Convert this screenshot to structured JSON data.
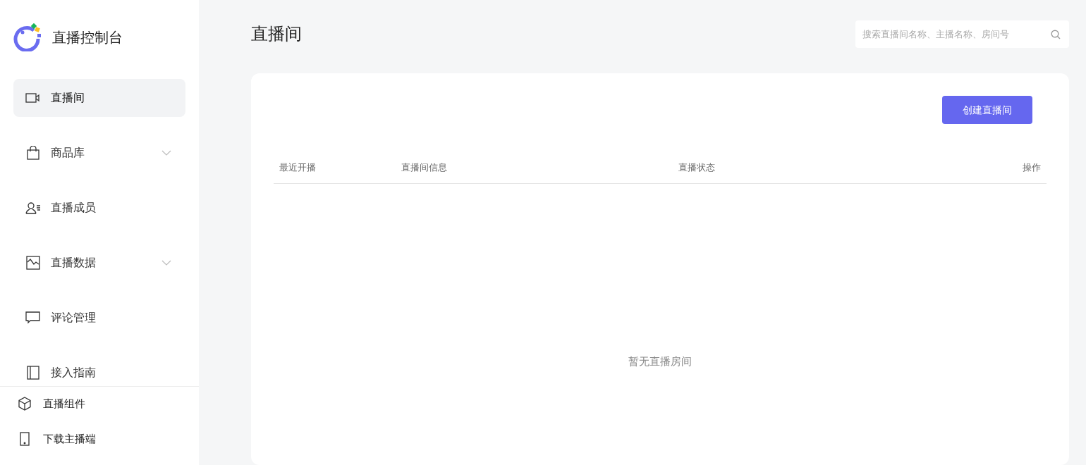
{
  "sidebar": {
    "title": "直播控制台",
    "nav": [
      {
        "label": "直播间",
        "selected": true,
        "has_submenu": false
      },
      {
        "label": "商品库",
        "selected": false,
        "has_submenu": true
      },
      {
        "label": "直播成员",
        "selected": false,
        "has_submenu": false
      },
      {
        "label": "直播数据",
        "selected": false,
        "has_submenu": true
      },
      {
        "label": "评论管理",
        "selected": false,
        "has_submenu": false
      },
      {
        "label": "接入指南",
        "selected": false,
        "has_submenu": false
      }
    ],
    "footer": [
      {
        "label": "直播组件"
      },
      {
        "label": "下载主播端"
      }
    ]
  },
  "page_title": "直播间",
  "search": {
    "placeholder": "搜索直播间名称、主播名称、房间号"
  },
  "create_button": "创建直播间",
  "table": {
    "columns": [
      "最近开播",
      "直播间信息",
      "直播状态",
      "操作"
    ],
    "empty_text": "暂无直播房间"
  }
}
